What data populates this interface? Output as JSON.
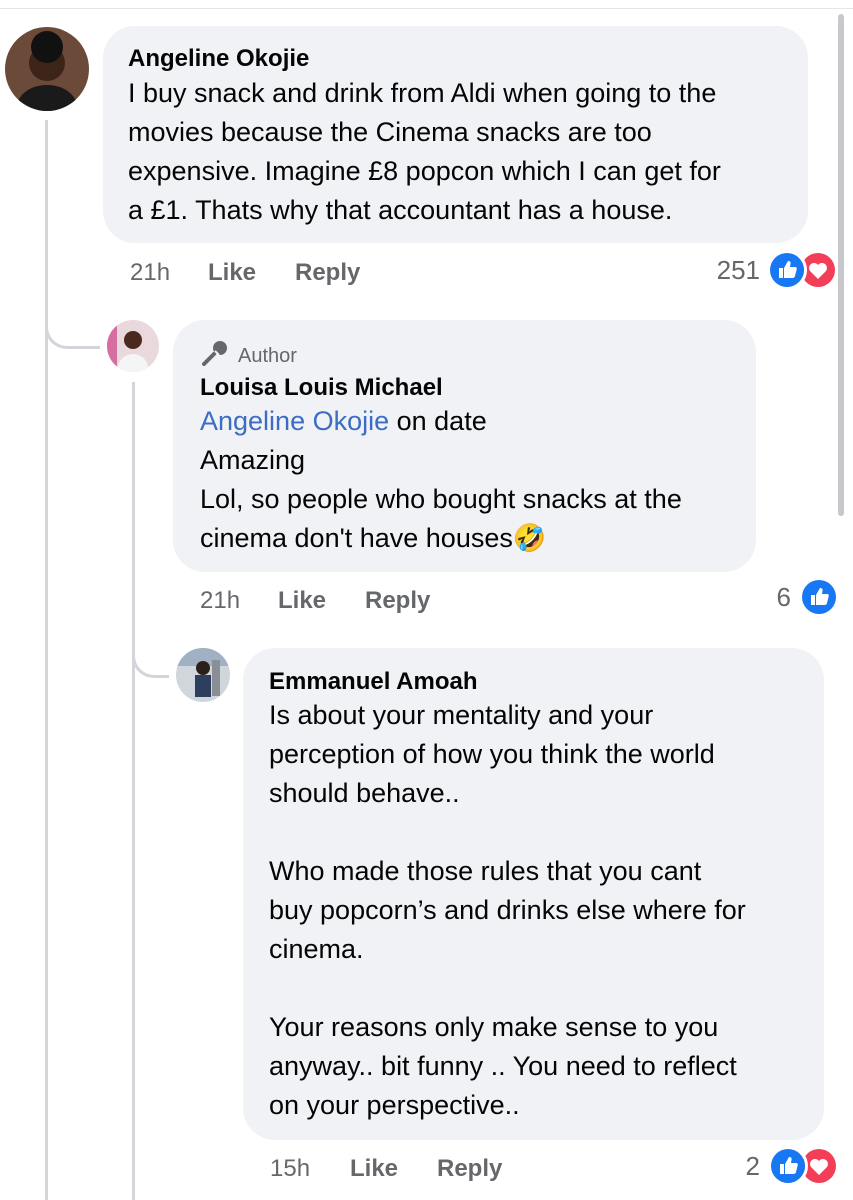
{
  "colors": {
    "like": "#1877f2",
    "love": "#f33e58",
    "bubble": "#f0f2f5",
    "muted": "#65676b",
    "mention": "#3c6cc3"
  },
  "comments": [
    {
      "author": "Angeline Okojie",
      "text": "I buy snack and drink from Aldi when going to the\nmovies because the Cinema snacks are  too\nexpensive. Imagine £8 popcon which I can get for\na £1. Thats why that accountant has a house.",
      "time": "21h",
      "like_label": "Like",
      "reply_label": "Reply",
      "reaction_count": "251",
      "reactions": [
        "like-icon",
        "love-icon"
      ]
    },
    {
      "badge": "Author",
      "badge_icon": "microphone-icon",
      "author": "Louisa Louis Michael",
      "mention": "Angeline Okojie",
      "mention_suffix": " on date",
      "text": "Amazing\nLol, so people who bought snacks at the\ncinema don't have houses",
      "emoji": "🤣",
      "time": "21h",
      "like_label": "Like",
      "reply_label": "Reply",
      "reaction_count": "6",
      "reactions": [
        "like-icon"
      ]
    },
    {
      "author": "Emmanuel Amoah",
      "text": "Is about your mentality and your\nperception of how  you think the world\nshould behave..\n\nWho made those rules that you cant\nbuy popcorn’s and drinks else where for\ncinema.\n\nYour reasons only make sense to you\nanyway.. bit funny .. You need to reflect\non your perspective..",
      "time": "15h",
      "like_label": "Like",
      "reply_label": "Reply",
      "reaction_count": "2",
      "reactions": [
        "like-icon",
        "love-icon"
      ]
    }
  ]
}
